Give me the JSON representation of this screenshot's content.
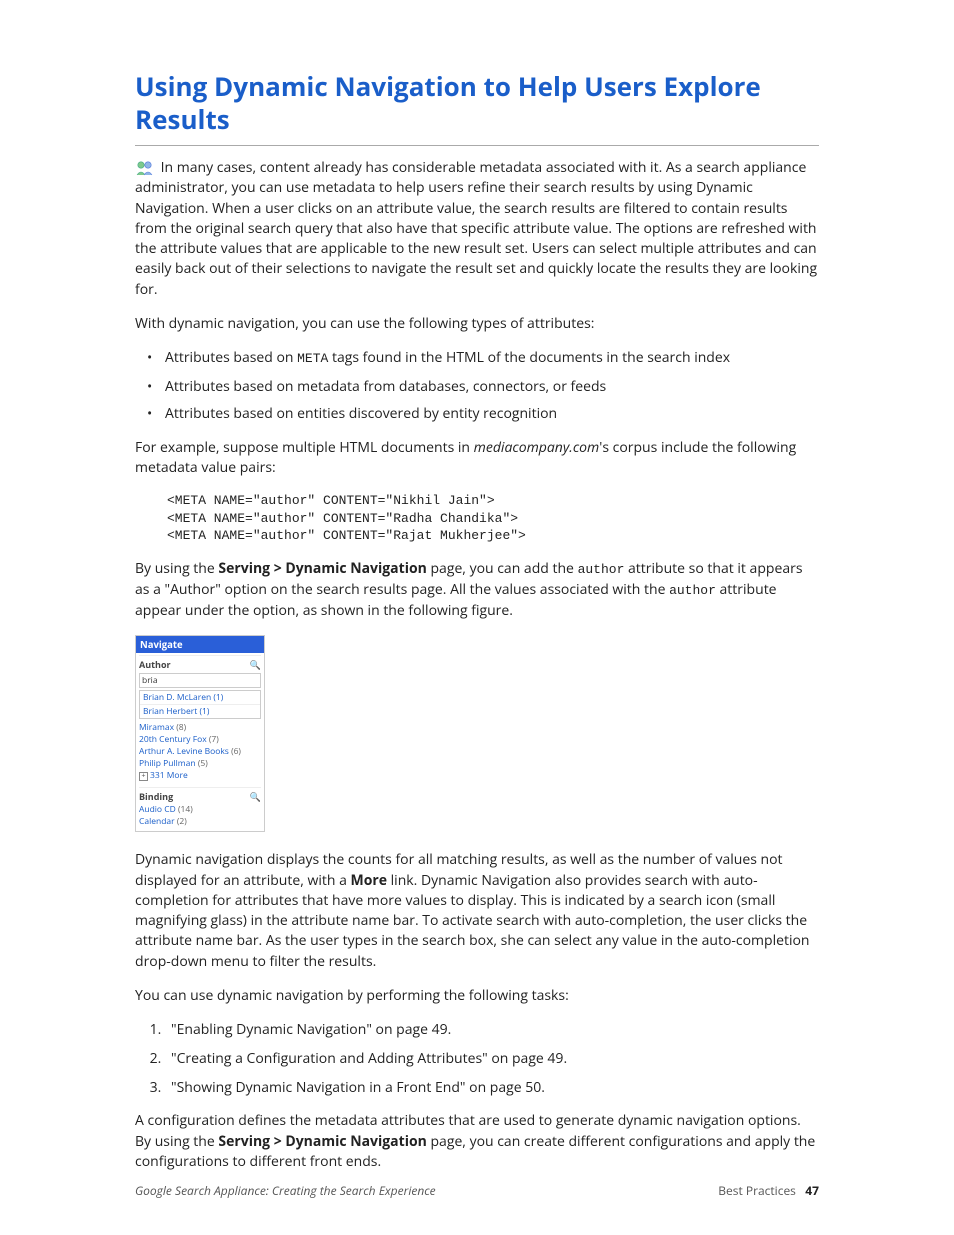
{
  "title": "Using Dynamic Navigation to Help Users Explore Results",
  "para1": "In many cases, content already has considerable metadata associated with it. As a search appliance administrator, you can use metadata to help users refine their search results by using Dynamic Navigation. When a user clicks on an attribute value, the search results are filtered to contain results from the original search query that also have that specific attribute value. The options are refreshed with the attribute values that are applicable to the new result set. Users can select multiple attributes and can easily back out of their selections to navigate the result set and quickly locate the results they are looking for.",
  "para2": "With dynamic navigation, you can use the following types of attributes:",
  "bullets": [
    {
      "pre": "Attributes based on ",
      "code": "META",
      "post": " tags found in the HTML of the documents in the search index"
    },
    {
      "pre": "Attributes based on metadata from databases, connectors, or feeds",
      "code": "",
      "post": ""
    },
    {
      "pre": "Attributes based on entities discovered by entity recognition",
      "code": "",
      "post": ""
    }
  ],
  "para3": {
    "pre": "For example, suppose multiple HTML documents in ",
    "domain": "mediacompany.com",
    "post": "'s corpus include the following metadata value pairs:"
  },
  "metas": [
    "<META NAME=\"author\" CONTENT=\"Nikhil Jain\">",
    "<META NAME=\"author\" CONTENT=\"Radha Chandika\">",
    "<META NAME=\"author\" CONTENT=\"Rajat Mukherjee\">"
  ],
  "para4": {
    "t1": "By using the ",
    "b1": "Serving > Dynamic Navigation",
    "t2": " page, you can add the ",
    "c1": "author",
    "t3": " attribute so that it appears as a \"Author\" option on the search results page. All the values associated with the ",
    "c2": "author",
    "t4": " attribute appear under the option, as shown in the following figure."
  },
  "navpanel": {
    "header": "Navigate",
    "author": {
      "title": "Author",
      "input": "bria",
      "sugg": [
        {
          "pre": "Brian D. McLaren",
          "count": "(1)"
        },
        {
          "pre": "Brian Herbert",
          "count": "(1)"
        }
      ],
      "items": [
        {
          "label": "Miramax",
          "cnt": "(8)"
        },
        {
          "label": "20th Century Fox",
          "cnt": "(7)"
        },
        {
          "label": "Arthur A. Levine Books",
          "cnt": "(6)"
        },
        {
          "label": "Philip Pullman",
          "cnt": "(5)"
        }
      ],
      "more": "331 More"
    },
    "binding": {
      "title": "Binding",
      "items": [
        {
          "label": "Audio CD",
          "cnt": "(14)"
        },
        {
          "label": "Calendar",
          "cnt": "(2)"
        }
      ]
    }
  },
  "para5": {
    "t1": "Dynamic navigation displays the counts for all matching results, as well as the number of values not displayed for an attribute, with a ",
    "b1": "More",
    "t2": " link. Dynamic Navigation also provides search with auto-completion for attributes that have more values to display. This is indicated by a search icon (small magnifying glass) in the attribute name bar. To activate search with auto-completion, the user clicks the attribute name bar. As the user types in the search box, she can select any value in the auto-completion drop-down menu to filter the results."
  },
  "para6": "You can use dynamic navigation by performing the following tasks:",
  "steps": [
    "\"Enabling Dynamic Navigation\" on page 49.",
    "\"Creating a Configuration and Adding Attributes\" on page 49.",
    "\"Showing Dynamic Navigation in a Front End\" on page 50."
  ],
  "para7": {
    "t1": "A configuration defines the metadata attributes that are used to generate dynamic navigation options. By using the ",
    "b1": "Serving > Dynamic Navigation",
    "t2": " page, you can create different configurations and apply the configurations to different front ends."
  },
  "footer": {
    "left": "Google Search Appliance: Creating the Search Experience",
    "right": "Best Practices",
    "page": "47"
  }
}
